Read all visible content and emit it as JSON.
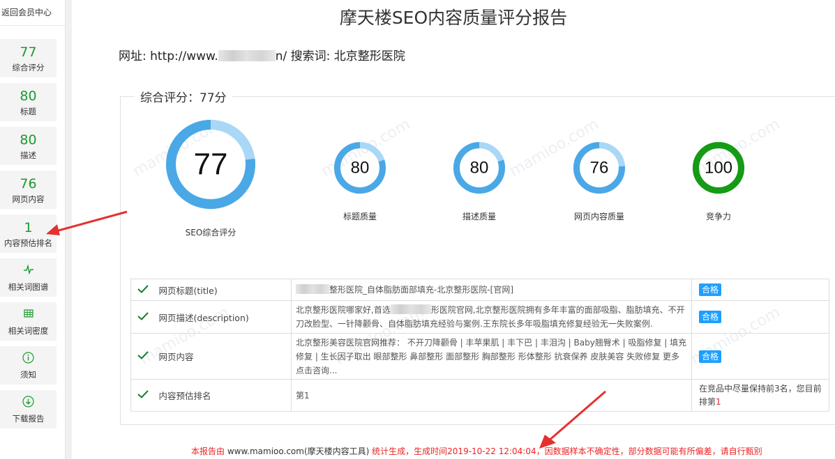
{
  "sidebar": {
    "back_label": "返回会员中心",
    "scores": [
      {
        "value": "77",
        "label": "综合评分"
      },
      {
        "value": "80",
        "label": "标题"
      },
      {
        "value": "80",
        "label": "描述"
      },
      {
        "value": "76",
        "label": "网页内容"
      },
      {
        "value": "1",
        "label": "内容预估排名"
      }
    ],
    "tools": [
      {
        "icon": "pulse-icon",
        "label": "相关词图谱"
      },
      {
        "icon": "grid-table-icon",
        "label": "相关词密度"
      },
      {
        "icon": "info-circle-icon",
        "label": "须知"
      },
      {
        "icon": "download-circle-icon",
        "label": "下载报告"
      }
    ]
  },
  "report": {
    "title": "摩天楼SEO内容质量评分报告",
    "url_prefix": "网址: http://www.",
    "url_suffix": "n/ 搜索词: 北京整形医院",
    "legend": "综合评分：77分"
  },
  "gauges": [
    {
      "value": 77,
      "label": "SEO综合评分",
      "color": "#4aa8e6",
      "track": "#a9d7f6"
    },
    {
      "value": 80,
      "label": "标题质量",
      "color": "#4aa8e6",
      "track": "#a9d7f6"
    },
    {
      "value": 80,
      "label": "描述质量",
      "color": "#4aa8e6",
      "track": "#a9d7f6"
    },
    {
      "value": 76,
      "label": "网页内容质量",
      "color": "#4aa8e6",
      "track": "#a9d7f6"
    },
    {
      "value": 100,
      "label": "竞争力",
      "color": "#159b15",
      "track": "#159b15"
    }
  ],
  "rows": [
    {
      "name": "网页标题(title)",
      "value": "整形医院_自体脂肪面部填充-北京整形医院-[官网]",
      "status": "合格"
    },
    {
      "name": "网页描述(description)",
      "value_a": "北京整形医院哪家好,首选",
      "value_b": "形医院官网,北京整形医院拥有多年丰富的面部吸脂、脂肪填充、不开刀改脸型、一针降颧骨、自体脂肪填充经验与案例.王东院长多年吸脂填充修复经验无一失败案例.",
      "status": "合格"
    },
    {
      "name": "网页内容",
      "value": "北京整形美容医院官网推荐： 不开刀降颧骨 | 丰苹果肌 | 丰下巴 | 丰泪沟 | Baby翘臀术 | 吸脂修复 | 填充修复 | 生长因子取出 眼部整形 鼻部整形 面部整形 胸部整形 形体整形 抗衰保养 皮肤美容 失败修复 更多 点击咨询...",
      "status": "合格"
    },
    {
      "name": "内容预估排名",
      "value": "第1",
      "note_a": "在竞品中尽量保持前3名，您目前排第",
      "note_rank": "1"
    }
  ],
  "footer": {
    "prefix": "本报告由 ",
    "site": "www.mamioo.com(摩天楼内容工具)",
    "suffix": " 统计生成，生成时间2019-10-22 12:04:04，因数据样本不确定性，部分数据可能有所偏差，请自行甄别"
  },
  "watermark": "mamioo.com"
}
